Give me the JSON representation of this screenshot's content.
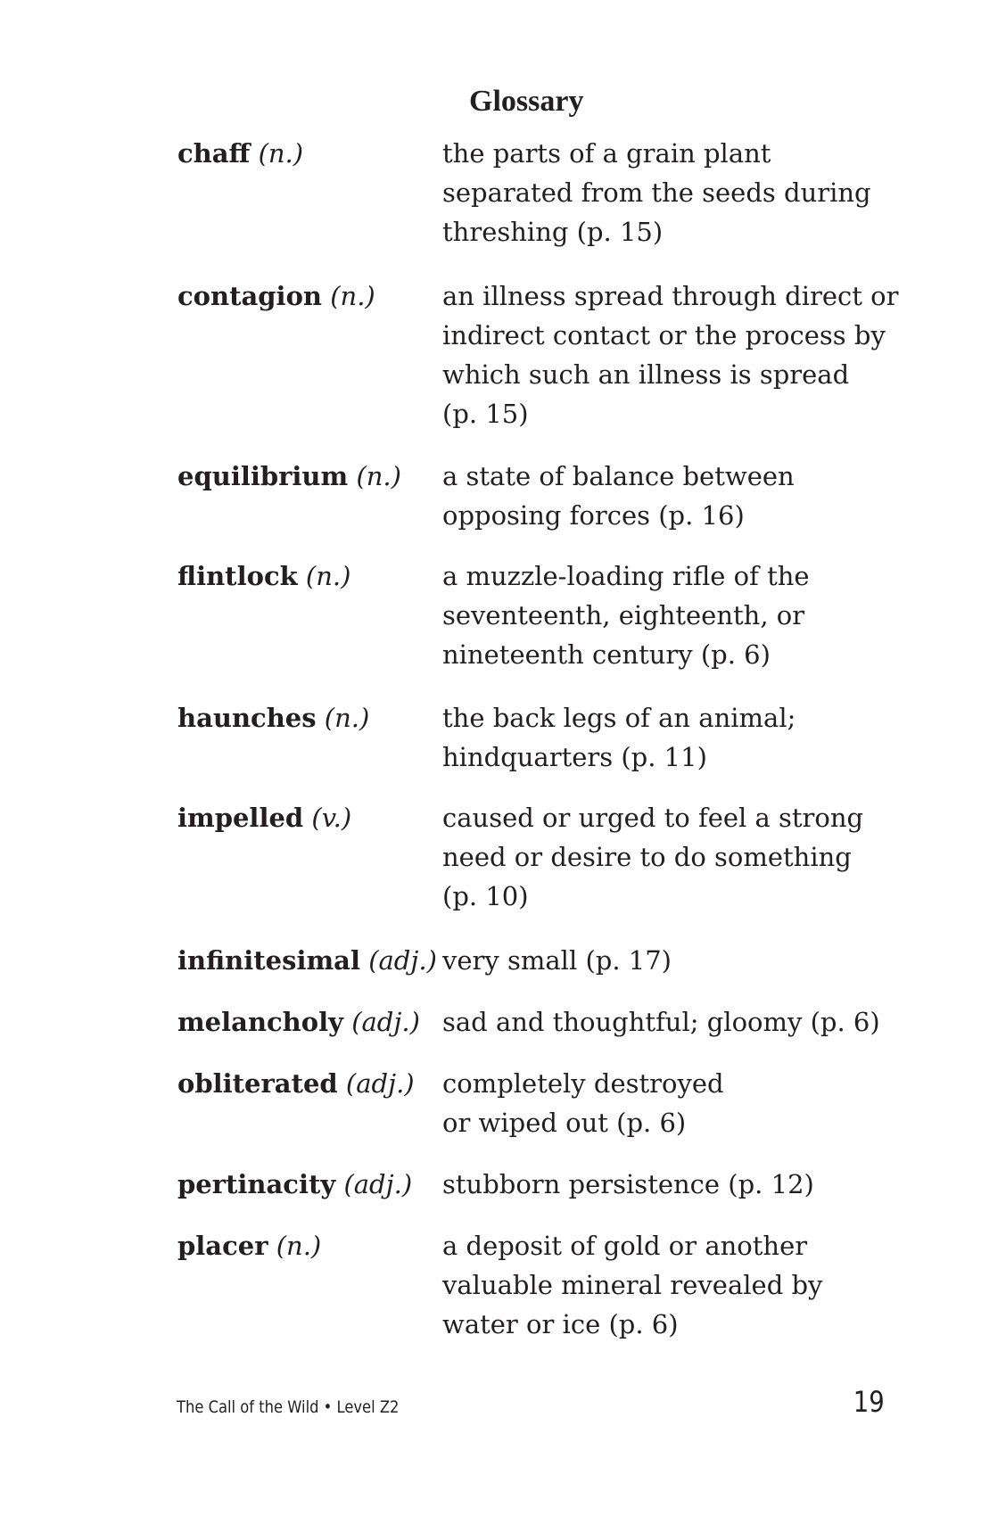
{
  "page": {
    "title": "Glossary",
    "footer": "The Call of the Wild • Level Z2",
    "page_number": "19"
  },
  "entries": [
    {
      "term": "chaff",
      "pos": "(n.)",
      "definition_lines": [
        "the parts of a grain plant",
        "separated from the seeds during",
        "threshing (p. 15)"
      ]
    },
    {
      "term": "contagion",
      "pos": "(n.)",
      "definition_lines": [
        "an illness spread through direct or",
        "indirect contact or the process by",
        "which such an illness is spread",
        "(p. 15)"
      ]
    },
    {
      "term": "equilibrium",
      "pos": "(n.)",
      "definition_lines": [
        "a state of balance between",
        "opposing forces (p. 16)"
      ]
    },
    {
      "term": "flintlock",
      "pos": "(n.)",
      "definition_lines": [
        "a muzzle-loading rifle of the",
        "seventeenth, eighteenth, or",
        "nineteenth century (p. 6)"
      ]
    },
    {
      "term": "haunches",
      "pos": "(n.)",
      "definition_lines": [
        "the back legs of an animal;",
        "hindquarters (p. 11)"
      ]
    },
    {
      "term": "impelled",
      "pos": "(v.)",
      "definition_lines": [
        "caused or urged to feel a strong",
        "need or desire to do something",
        "(p. 10)"
      ]
    },
    {
      "term": "infinitesimal",
      "pos": "(adj.)",
      "definition_lines": [
        "very small (p. 17)"
      ]
    },
    {
      "term": "melancholy",
      "pos": "(adj.)",
      "definition_lines": [
        "sad and thoughtful; gloomy (p. 6)"
      ]
    },
    {
      "term": "obliterated",
      "pos": "(adj.)",
      "definition_lines": [
        "completely destroyed",
        "or wiped out (p. 6)"
      ]
    },
    {
      "term": "pertinacity",
      "pos": "(adj.)",
      "definition_lines": [
        "stubborn persistence (p. 12)"
      ]
    },
    {
      "term": "placer",
      "pos": "(n.)",
      "definition_lines": [
        "a deposit of gold or another",
        "valuable mineral revealed by",
        "water or ice (p. 6)"
      ]
    }
  ]
}
